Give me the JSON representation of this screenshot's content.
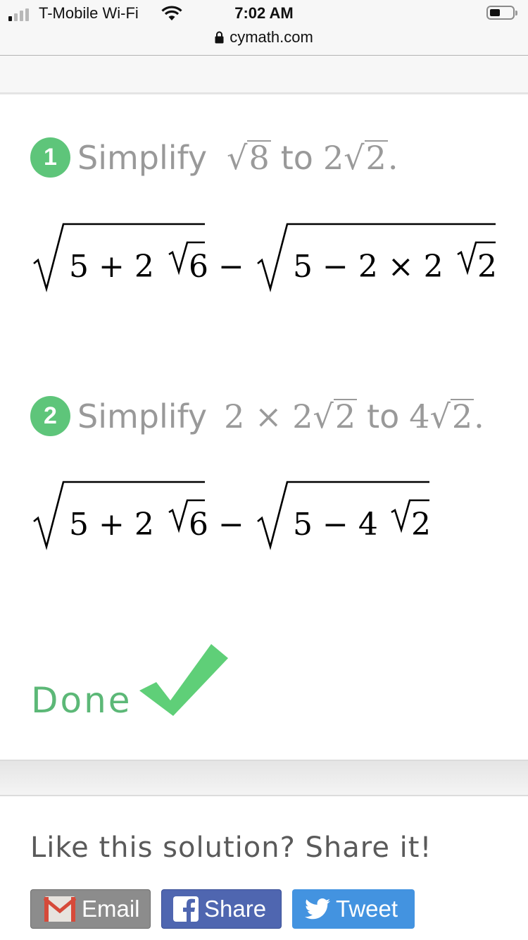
{
  "status_bar": {
    "carrier": "T-Mobile Wi-Fi",
    "time": "7:02 AM",
    "url": "cymath.com",
    "signal_bars_active": 1,
    "signal_bars_total": 4
  },
  "steps": [
    {
      "number": "1",
      "verb": "Simplify",
      "from_radicand": "8",
      "connector": "to",
      "to_coef": "2",
      "to_radicand": "2",
      "period": ".",
      "expression": {
        "left_radicand_prefix": "5 + 2",
        "left_inner_radicand": "6",
        "operator": "−",
        "right_radicand_prefix": "5 − 2 × 2",
        "right_inner_radicand": "2"
      }
    },
    {
      "number": "2",
      "verb": "Simplify",
      "from_prefix": "2 × 2",
      "from_radicand": "2",
      "connector": "to",
      "to_coef": "4",
      "to_radicand": "2",
      "period": ".",
      "expression": {
        "left_radicand_prefix": "5 + 2",
        "left_inner_radicand": "6",
        "operator": "−",
        "right_radicand_prefix": "5 − 4",
        "right_inner_radicand": "2"
      }
    }
  ],
  "done": {
    "label": "Done",
    "icon": "checkmark-icon"
  },
  "share": {
    "title": "Like this solution? Share it!",
    "buttons": [
      {
        "label": "Email",
        "icon": "gmail-icon",
        "color": "#8c8c8c"
      },
      {
        "label": "Share",
        "icon": "facebook-icon",
        "color": "#4f66b0"
      },
      {
        "label": "Tweet",
        "icon": "twitter-icon",
        "color": "#4393e0"
      }
    ]
  },
  "colors": {
    "accent_green": "#5ec57a",
    "step_text": "#999999",
    "math_text": "#000000"
  }
}
